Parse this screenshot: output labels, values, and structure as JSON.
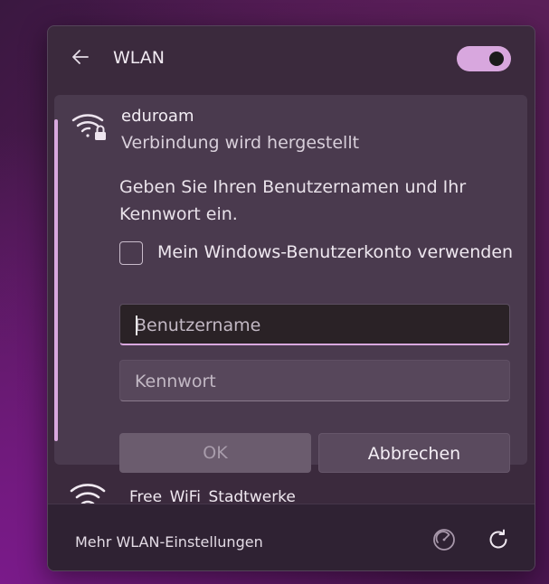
{
  "header": {
    "title": "WLAN",
    "wifi_enabled": true
  },
  "active_network": {
    "name": "eduroam",
    "status": "Verbindung wird hergestellt",
    "prompt": "Geben Sie Ihren Benutzernamen und Ihr Kennwort ein.",
    "use_windows_account_label": "Mein Windows-Benutzerkonto verwenden",
    "use_windows_account_checked": false,
    "username_placeholder": "Benutzername",
    "password_placeholder": "Kennwort",
    "ok_label": "OK",
    "cancel_label": "Abbrechen"
  },
  "next_network": {
    "name": "Free_WiFi_Stadtwerke"
  },
  "footer": {
    "more_settings_label": "Mehr WLAN-Einstellungen"
  },
  "colors": {
    "accent": "#d9a8df",
    "panel": "#3b2a3d"
  }
}
